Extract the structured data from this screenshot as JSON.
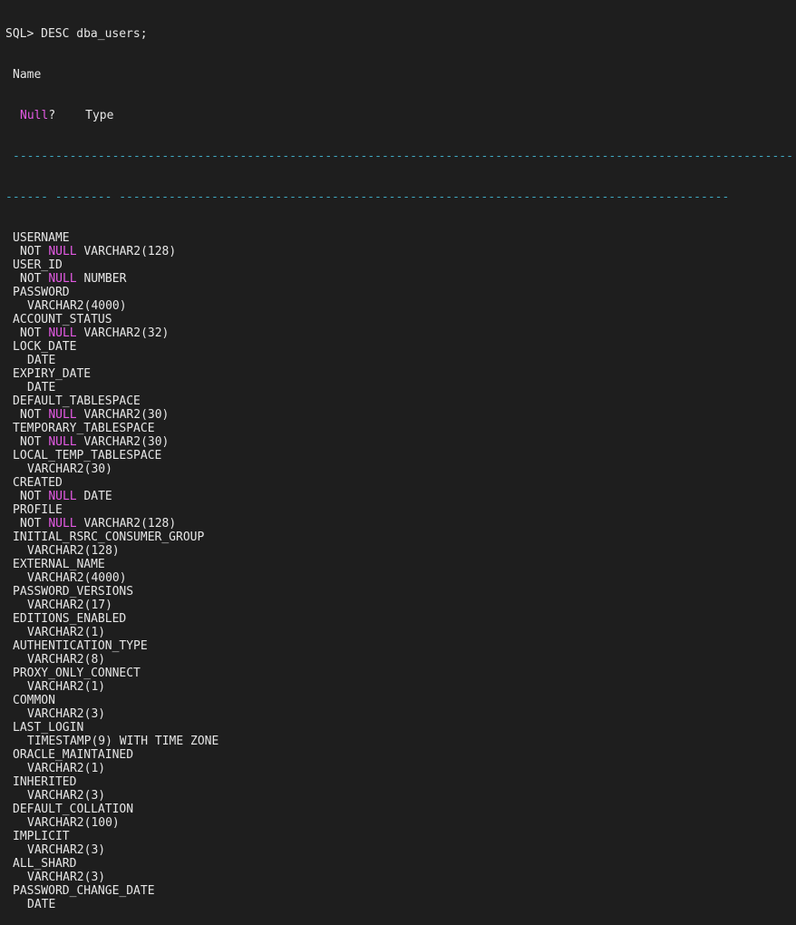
{
  "prompt": "SQL>",
  "command": "DESC dba_users;",
  "headers": {
    "name": "Name",
    "null": "Null",
    "null_suffix": "?",
    "type": "Type"
  },
  "separator": {
    "line1": "--------------------------------------------------------------------------------------------------------------",
    "line2": "------ -------- --------------------------------------------------------------------------------------"
  },
  "keywords": {
    "not": "NOT",
    "null": "NULL"
  },
  "columns": [
    {
      "name": "USERNAME",
      "not_null": true,
      "type": "VARCHAR2(128)"
    },
    {
      "name": "USER_ID",
      "not_null": true,
      "type": "NUMBER"
    },
    {
      "name": "PASSWORD",
      "not_null": false,
      "type": "VARCHAR2(4000)"
    },
    {
      "name": "ACCOUNT_STATUS",
      "not_null": true,
      "type": "VARCHAR2(32)"
    },
    {
      "name": "LOCK_DATE",
      "not_null": false,
      "type": "DATE"
    },
    {
      "name": "EXPIRY_DATE",
      "not_null": false,
      "type": "DATE"
    },
    {
      "name": "DEFAULT_TABLESPACE",
      "not_null": true,
      "type": "VARCHAR2(30)"
    },
    {
      "name": "TEMPORARY_TABLESPACE",
      "not_null": true,
      "type": "VARCHAR2(30)"
    },
    {
      "name": "LOCAL_TEMP_TABLESPACE",
      "not_null": false,
      "type": "VARCHAR2(30)"
    },
    {
      "name": "CREATED",
      "not_null": true,
      "type": "DATE"
    },
    {
      "name": "PROFILE",
      "not_null": true,
      "type": "VARCHAR2(128)"
    },
    {
      "name": "INITIAL_RSRC_CONSUMER_GROUP",
      "not_null": false,
      "type": "VARCHAR2(128)"
    },
    {
      "name": "EXTERNAL_NAME",
      "not_null": false,
      "type": "VARCHAR2(4000)"
    },
    {
      "name": "PASSWORD_VERSIONS",
      "not_null": false,
      "type": "VARCHAR2(17)"
    },
    {
      "name": "EDITIONS_ENABLED",
      "not_null": false,
      "type": "VARCHAR2(1)"
    },
    {
      "name": "AUTHENTICATION_TYPE",
      "not_null": false,
      "type": "VARCHAR2(8)"
    },
    {
      "name": "PROXY_ONLY_CONNECT",
      "not_null": false,
      "type": "VARCHAR2(1)"
    },
    {
      "name": "COMMON",
      "not_null": false,
      "type": "VARCHAR2(3)"
    },
    {
      "name": "LAST_LOGIN",
      "not_null": false,
      "type": "TIMESTAMP(9) WITH TIME ZONE"
    },
    {
      "name": "ORACLE_MAINTAINED",
      "not_null": false,
      "type": "VARCHAR2(1)"
    },
    {
      "name": "INHERITED",
      "not_null": false,
      "type": "VARCHAR2(3)"
    },
    {
      "name": "DEFAULT_COLLATION",
      "not_null": false,
      "type": "VARCHAR2(100)"
    },
    {
      "name": "IMPLICIT",
      "not_null": false,
      "type": "VARCHAR2(3)"
    },
    {
      "name": "ALL_SHARD",
      "not_null": false,
      "type": "VARCHAR2(3)"
    },
    {
      "name": "PASSWORD_CHANGE_DATE",
      "not_null": false,
      "type": "DATE"
    }
  ],
  "colors": {
    "background": "#1e1e1e",
    "text": "#e6e6e6",
    "keyword": "#e35ae3",
    "separator": "#3fa7bf"
  }
}
